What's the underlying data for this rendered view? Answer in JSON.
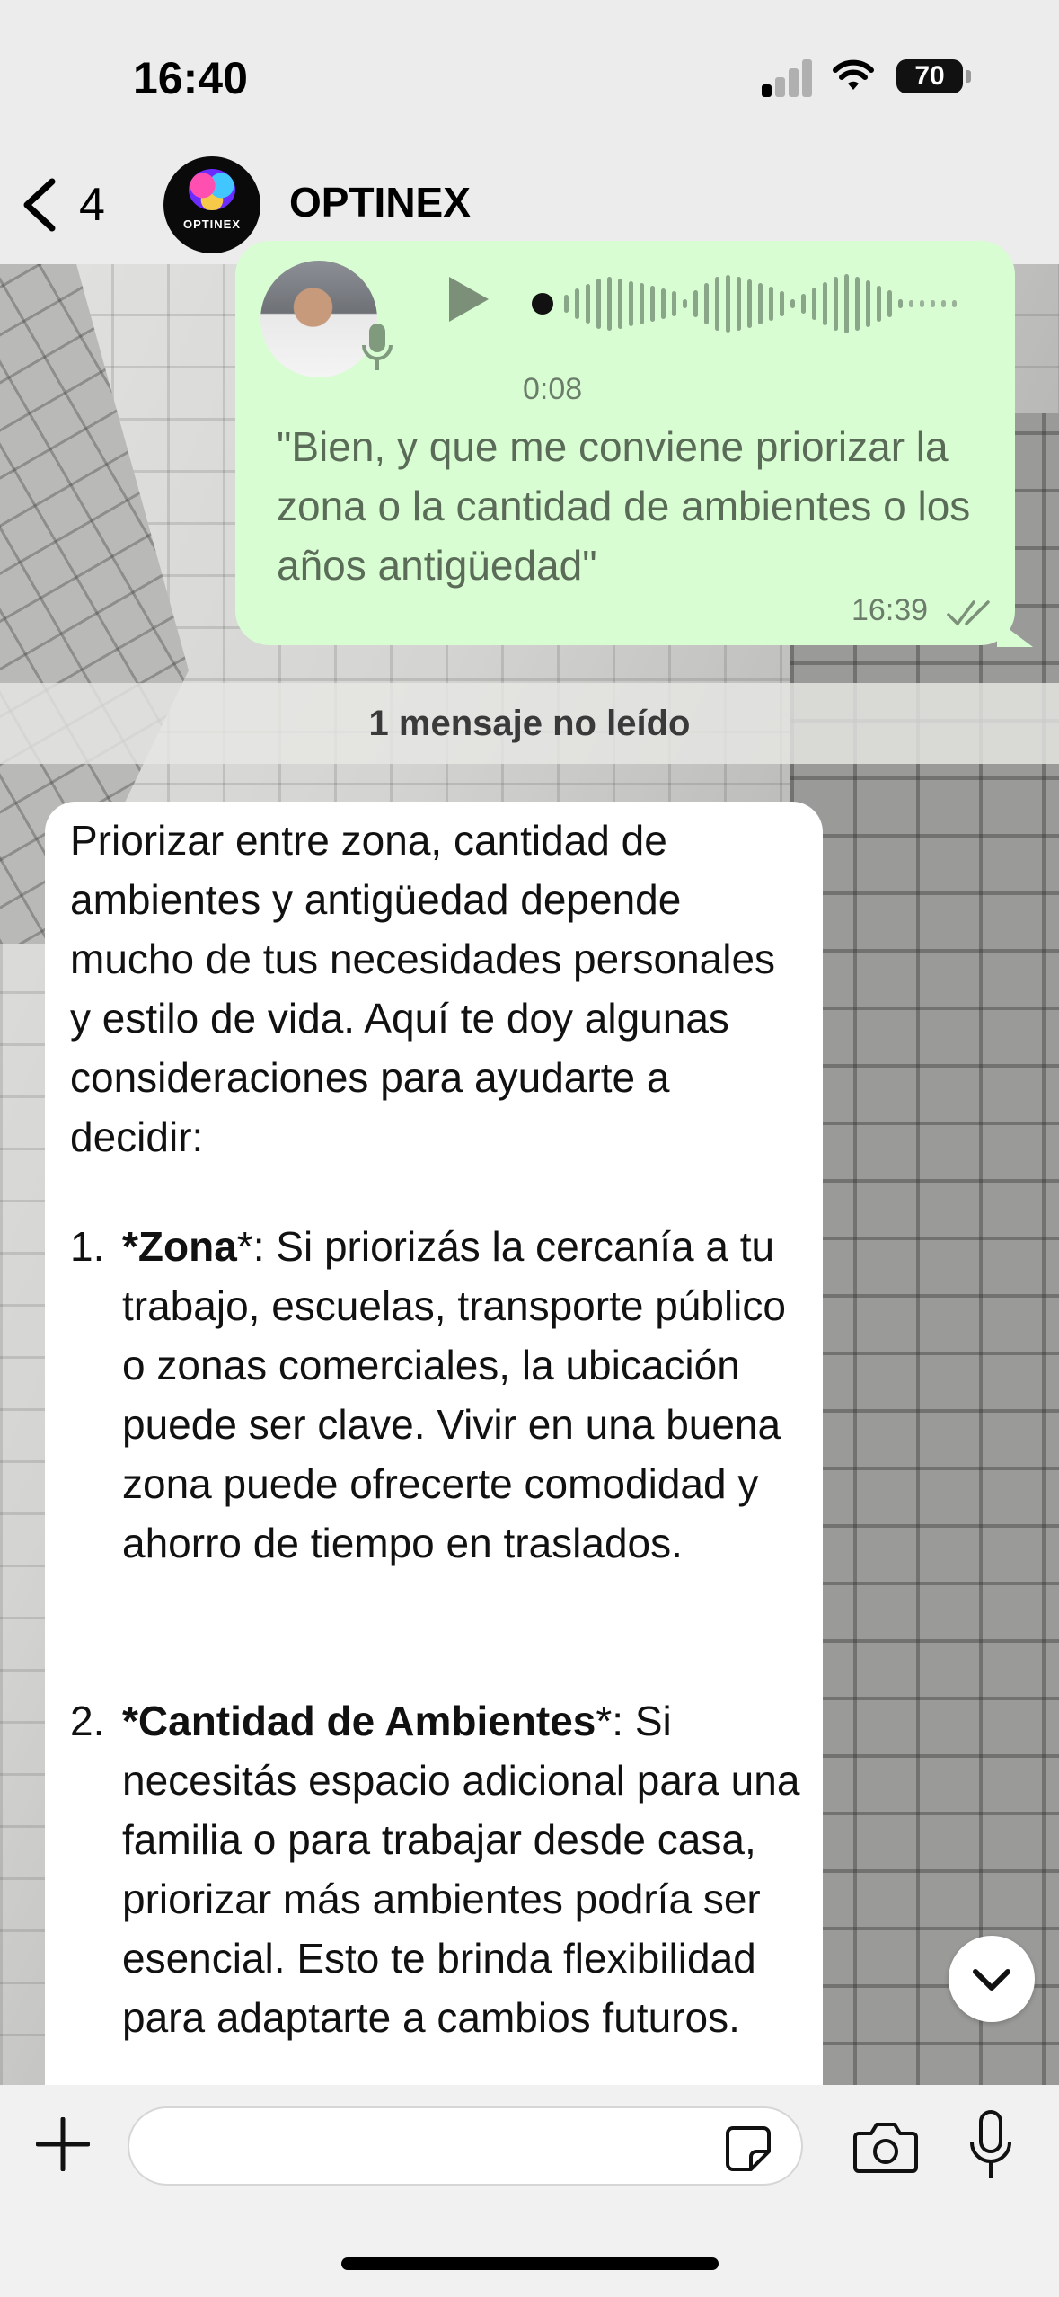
{
  "status_bar": {
    "time": "16:40",
    "battery": "70"
  },
  "header": {
    "back_count": "4",
    "chat_name": "OPTINEX",
    "avatar_label": "OPTINEX"
  },
  "voice_message": {
    "duration": "0:08",
    "transcript": "\"Bien, y que me conviene priorizar la zona o la cantidad de ambientes o los años antigüedad\"",
    "time": "16:39"
  },
  "unread": {
    "label": "1 mensaje no leído"
  },
  "incoming_message": {
    "intro": "Priorizar entre zona, cantidad de ambientes y antigüedad depende mucho de tus necesidades personales y estilo de vida. Aquí te doy algunas consideraciones para ayudarte a decidir:",
    "items": [
      {
        "number": "1.",
        "prefix": "*",
        "heading": "Zona",
        "suffix": "*",
        "text": ": Si priorizás la cercanía a tu trabajo, escuelas, transporte público o zonas comerciales, la ubicación puede ser clave. Vivir en una buena zona puede ofrecerte comodidad y ahorro de tiempo en traslados."
      },
      {
        "number": "2.",
        "prefix": "*",
        "heading": "Cantidad de Ambientes",
        "suffix": "*",
        "text": ": Si necesitás espacio adicional para una familia o para trabajar desde casa, priorizar más ambientes podría ser esencial. Esto te brinda flexibilidad para adaptarte a cambios futuros."
      }
    ]
  },
  "input": {
    "placeholder": "",
    "value": ""
  },
  "colors": {
    "outgoing_bubble": "#d9fdd3",
    "incoming_bubble": "#ffffff",
    "bars": "#ececec"
  },
  "icons": [
    "back-chevron-icon",
    "play-icon",
    "microphone-icon",
    "double-check-icon",
    "chevron-down-icon",
    "plus-icon",
    "sticker-icon",
    "camera-icon",
    "signal-icon",
    "wifi-icon"
  ]
}
